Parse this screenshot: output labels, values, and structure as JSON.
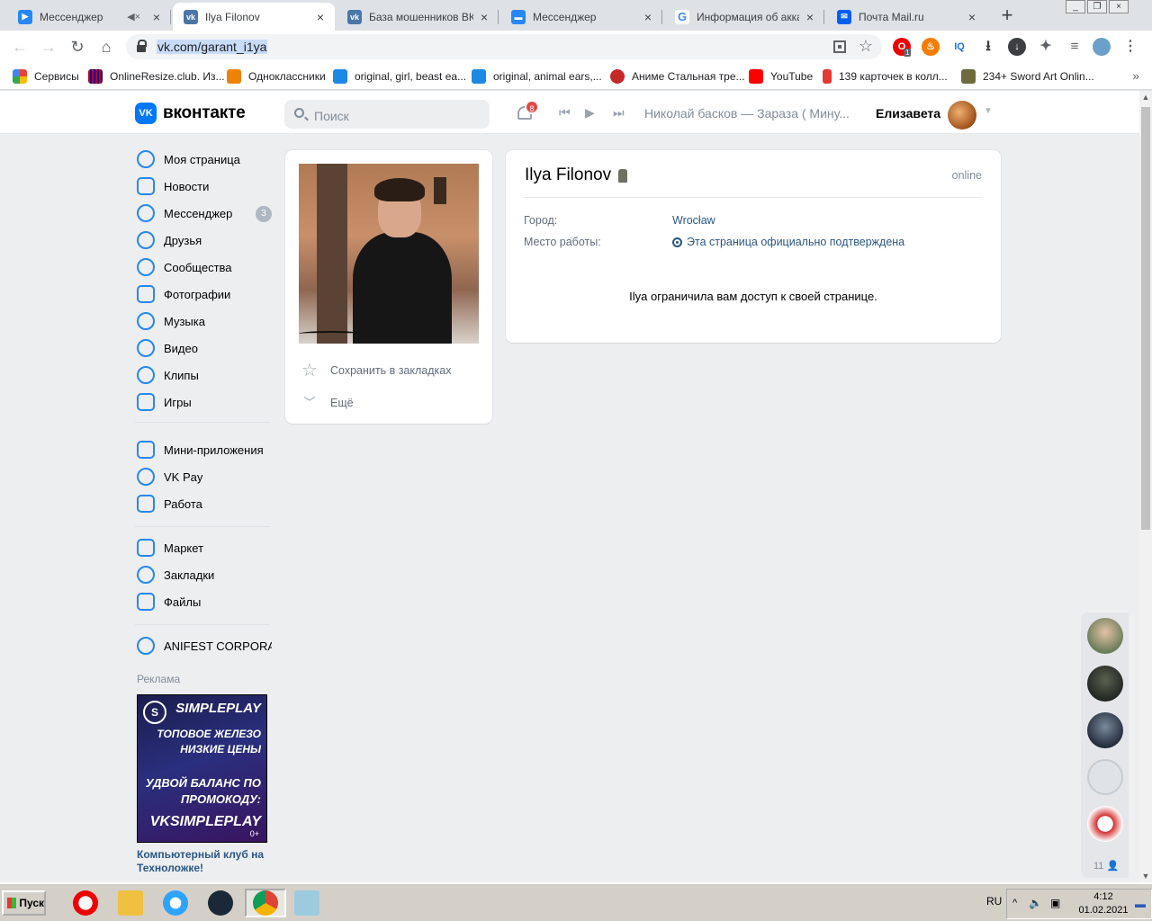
{
  "browser": {
    "tabs": [
      {
        "title": "Мессенджер",
        "icon": "vk-messenger-icon",
        "muted": true
      },
      {
        "title": "Ilya Filonov",
        "icon": "vk-icon",
        "active": true
      },
      {
        "title": "База мошенников ВКон",
        "icon": "vk-icon"
      },
      {
        "title": "Мессенджер",
        "icon": "vk-messenger-icon"
      },
      {
        "title": "Информация об аккаун",
        "icon": "google-icon"
      },
      {
        "title": "Почта Mail.ru",
        "icon": "mail-icon"
      }
    ],
    "url": "vk.com/garant_i1ya",
    "extensions": {
      "opera_badge": "1"
    },
    "bookmarks": [
      "Сервисы",
      "OnlineResize.club. Из...",
      "Одноклассники",
      "original, girl, beast ea...",
      "original, animal ears,...",
      "Аниме Стальная тре...",
      "YouTube",
      "139 карточек в колл...",
      "234+ Sword Art Onlin..."
    ]
  },
  "vk": {
    "logo_text": "вконтакте",
    "search_placeholder": "Поиск",
    "notifications_count": "8",
    "now_playing": "Николай басков — Зараза ( Мину...",
    "user_name": "Елизавета",
    "menu": {
      "group1": [
        {
          "label": "Моя страница",
          "icon": "user-icon"
        },
        {
          "label": "Новости",
          "icon": "news-icon"
        },
        {
          "label": "Мессенджер",
          "icon": "message-icon",
          "count": "3"
        },
        {
          "label": "Друзья",
          "icon": "friends-icon"
        },
        {
          "label": "Сообщества",
          "icon": "communities-icon"
        },
        {
          "label": "Фотографии",
          "icon": "photo-icon"
        },
        {
          "label": "Музыка",
          "icon": "music-icon"
        },
        {
          "label": "Видео",
          "icon": "video-icon"
        },
        {
          "label": "Клипы",
          "icon": "clips-icon"
        },
        {
          "label": "Игры",
          "icon": "games-icon"
        }
      ],
      "group2": [
        {
          "label": "Мини-приложения",
          "icon": "apps-icon"
        },
        {
          "label": "VK Pay",
          "icon": "vkpay-icon"
        },
        {
          "label": "Работа",
          "icon": "work-icon"
        }
      ],
      "group3": [
        {
          "label": "Маркет",
          "icon": "market-icon"
        },
        {
          "label": "Закладки",
          "icon": "bookmark-star-icon"
        },
        {
          "label": "Файлы",
          "icon": "files-icon"
        }
      ],
      "group4": [
        {
          "label": "ANIFEST CORPORA...",
          "icon": "community-icon"
        }
      ]
    },
    "ad": {
      "label": "Реклама",
      "brand": "SimplePlay",
      "lines": [
        "ТОПОВОЕ ЖЕЛЕЗО",
        "НИЗКИЕ ЦЕНЫ",
        "УДВОЙ БАЛАНС ПО",
        "ПРОМОКОДУ:",
        "VKSIMPLEPLAY"
      ],
      "age": "0+",
      "caption": "Компьютерный клуб на Техноложке!"
    },
    "profile": {
      "name": "Ilya Filonov",
      "status": "online",
      "city_label": "Город:",
      "city": "Wrocław",
      "work_label": "Место работы:",
      "work": "Эта страница официально подтверждена",
      "restricted_text": "Ilya ограничила вам доступ к своей странице.",
      "save_bookmark": "Сохранить в закладках",
      "more": "Ещё"
    },
    "chat_strip": {
      "online_count": "11"
    }
  },
  "taskbar": {
    "start": "Пуск",
    "lang": "RU",
    "time": "4:12",
    "date": "01.02.2021"
  }
}
